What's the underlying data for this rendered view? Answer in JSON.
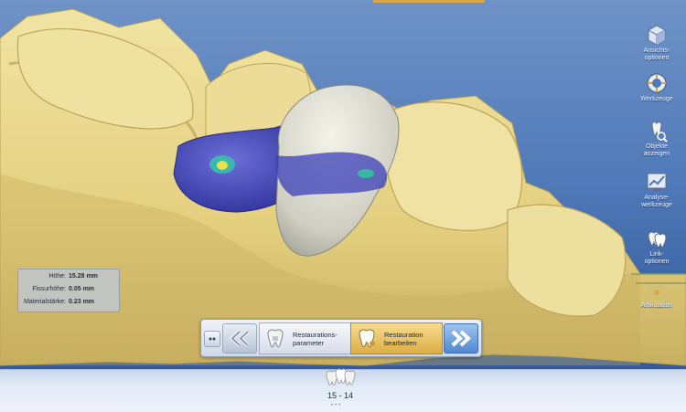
{
  "workflow": {
    "step1_label": "Restaurations-\nparameter",
    "step2_label": "Restauration\nbearbeiten"
  },
  "measurements": [
    {
      "label": "Höhe:",
      "value": "15.28 mm"
    },
    {
      "label": "Fissurhöhe:",
      "value": "0.05 mm"
    },
    {
      "label": "Materialstärke:",
      "value": "0.23 mm"
    }
  ],
  "toolbar": [
    {
      "label": "Ansichts-\noptionen",
      "icon": "cube-view-icon"
    },
    {
      "label": "Werkzeuge",
      "icon": "tools-ring-icon"
    },
    {
      "label": "Objekte\nanzeigen",
      "icon": "objects-icon"
    },
    {
      "label": "Analyse-\nwerkzeuge",
      "icon": "analysis-icon"
    },
    {
      "label": "Link-\noptionen",
      "icon": "link-icon"
    },
    {
      "label": "Artikulation",
      "icon": "articulator-icon"
    }
  ],
  "tooth_selector": {
    "label": "15 - 14"
  },
  "colors": {
    "background": "#4f79b8",
    "jaw": "#e6d58a",
    "accent": "#d7a64a",
    "restoration": "#d9d8cc",
    "heatmap": "#3b3fb8"
  }
}
